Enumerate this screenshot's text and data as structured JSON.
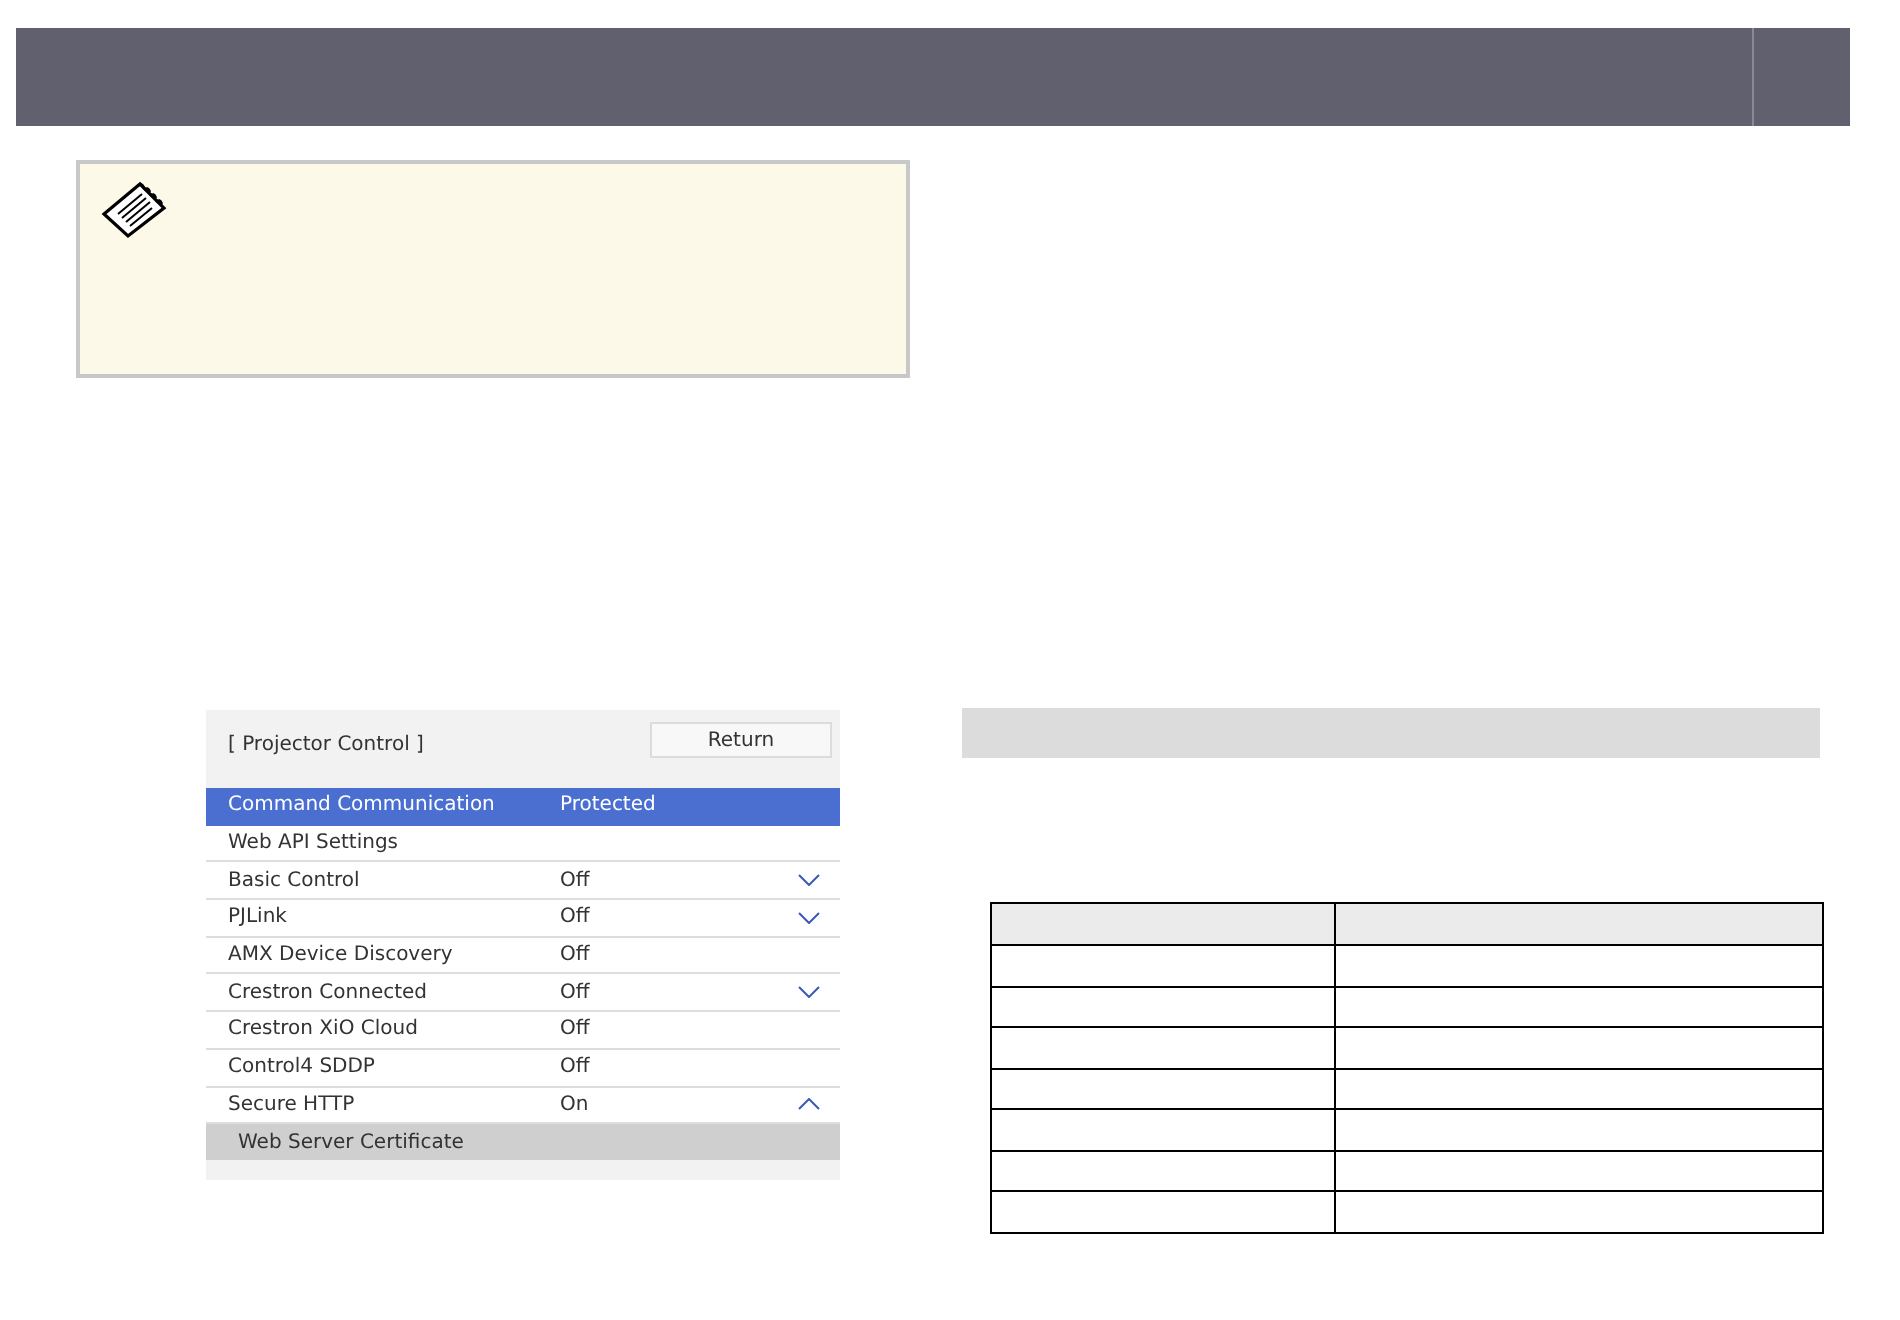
{
  "menu": {
    "title": "[ Projector Control ]",
    "return_button": "Return",
    "rows": [
      {
        "label": "Command Communication",
        "value": "Protected",
        "selected": true
      },
      {
        "label": "Web API Settings",
        "selected": false
      },
      {
        "label": "Basic Control",
        "value": "Off",
        "expanded": false,
        "selected": false
      },
      {
        "label": "PJLink",
        "value": "Off",
        "expanded": false,
        "selected": false
      },
      {
        "label": "AMX Device Discovery",
        "value": "Off",
        "selected": false
      },
      {
        "label": "Crestron Connected",
        "value": "Off",
        "expanded": false,
        "selected": false
      },
      {
        "label": "Crestron XiO Cloud",
        "value": "Off",
        "selected": false
      },
      {
        "label": "Control4 SDDP",
        "value": "Off",
        "selected": false
      },
      {
        "label": "Secure HTTP",
        "value": "On",
        "expanded": true,
        "selected": false
      }
    ],
    "sub_item": "Web Server Certificate"
  }
}
